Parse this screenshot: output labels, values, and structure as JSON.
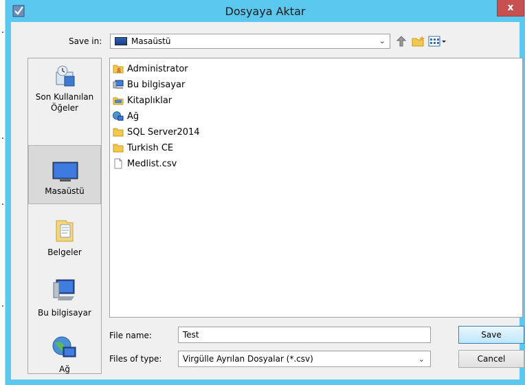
{
  "window": {
    "title": "Dosyaya Aktar",
    "close_glyph": "x"
  },
  "toolbar": {
    "save_in_label": "Save in:",
    "save_in_value": "Masaüstü",
    "icons": [
      "up-folder-icon",
      "new-folder-icon",
      "view-menu-icon"
    ]
  },
  "places": [
    {
      "label": "Son Kullanılan Öğeler",
      "icon": "recent-items-icon",
      "selected": false
    },
    {
      "label": "Masaüstü",
      "icon": "desktop-icon",
      "selected": true
    },
    {
      "label": "Belgeler",
      "icon": "documents-icon",
      "selected": false
    },
    {
      "label": "Bu bilgisayar",
      "icon": "computer-icon",
      "selected": false
    },
    {
      "label": "Ağ",
      "icon": "network-icon",
      "selected": false
    }
  ],
  "files": [
    {
      "name": "Administrator",
      "icon": "user-folder-icon"
    },
    {
      "name": "Bu bilgisayar",
      "icon": "computer-icon"
    },
    {
      "name": "Kitaplıklar",
      "icon": "libraries-icon"
    },
    {
      "name": "Ağ",
      "icon": "network-icon"
    },
    {
      "name": "SQL Server2014",
      "icon": "folder-icon"
    },
    {
      "name": "Turkish CE",
      "icon": "folder-icon"
    },
    {
      "name": "Medlist.csv",
      "icon": "file-icon"
    }
  ],
  "form": {
    "file_name_label": "File name:",
    "file_name_value": "Test",
    "file_type_label": "Files of type:",
    "file_type_value": "Virgülle Ayrılan Dosyalar (*.csv)"
  },
  "buttons": {
    "save": "Save",
    "cancel": "Cancel"
  },
  "colors": {
    "titlebar": "#5bc8f0",
    "close": "#c75050",
    "selection": "#d9d9d9"
  }
}
